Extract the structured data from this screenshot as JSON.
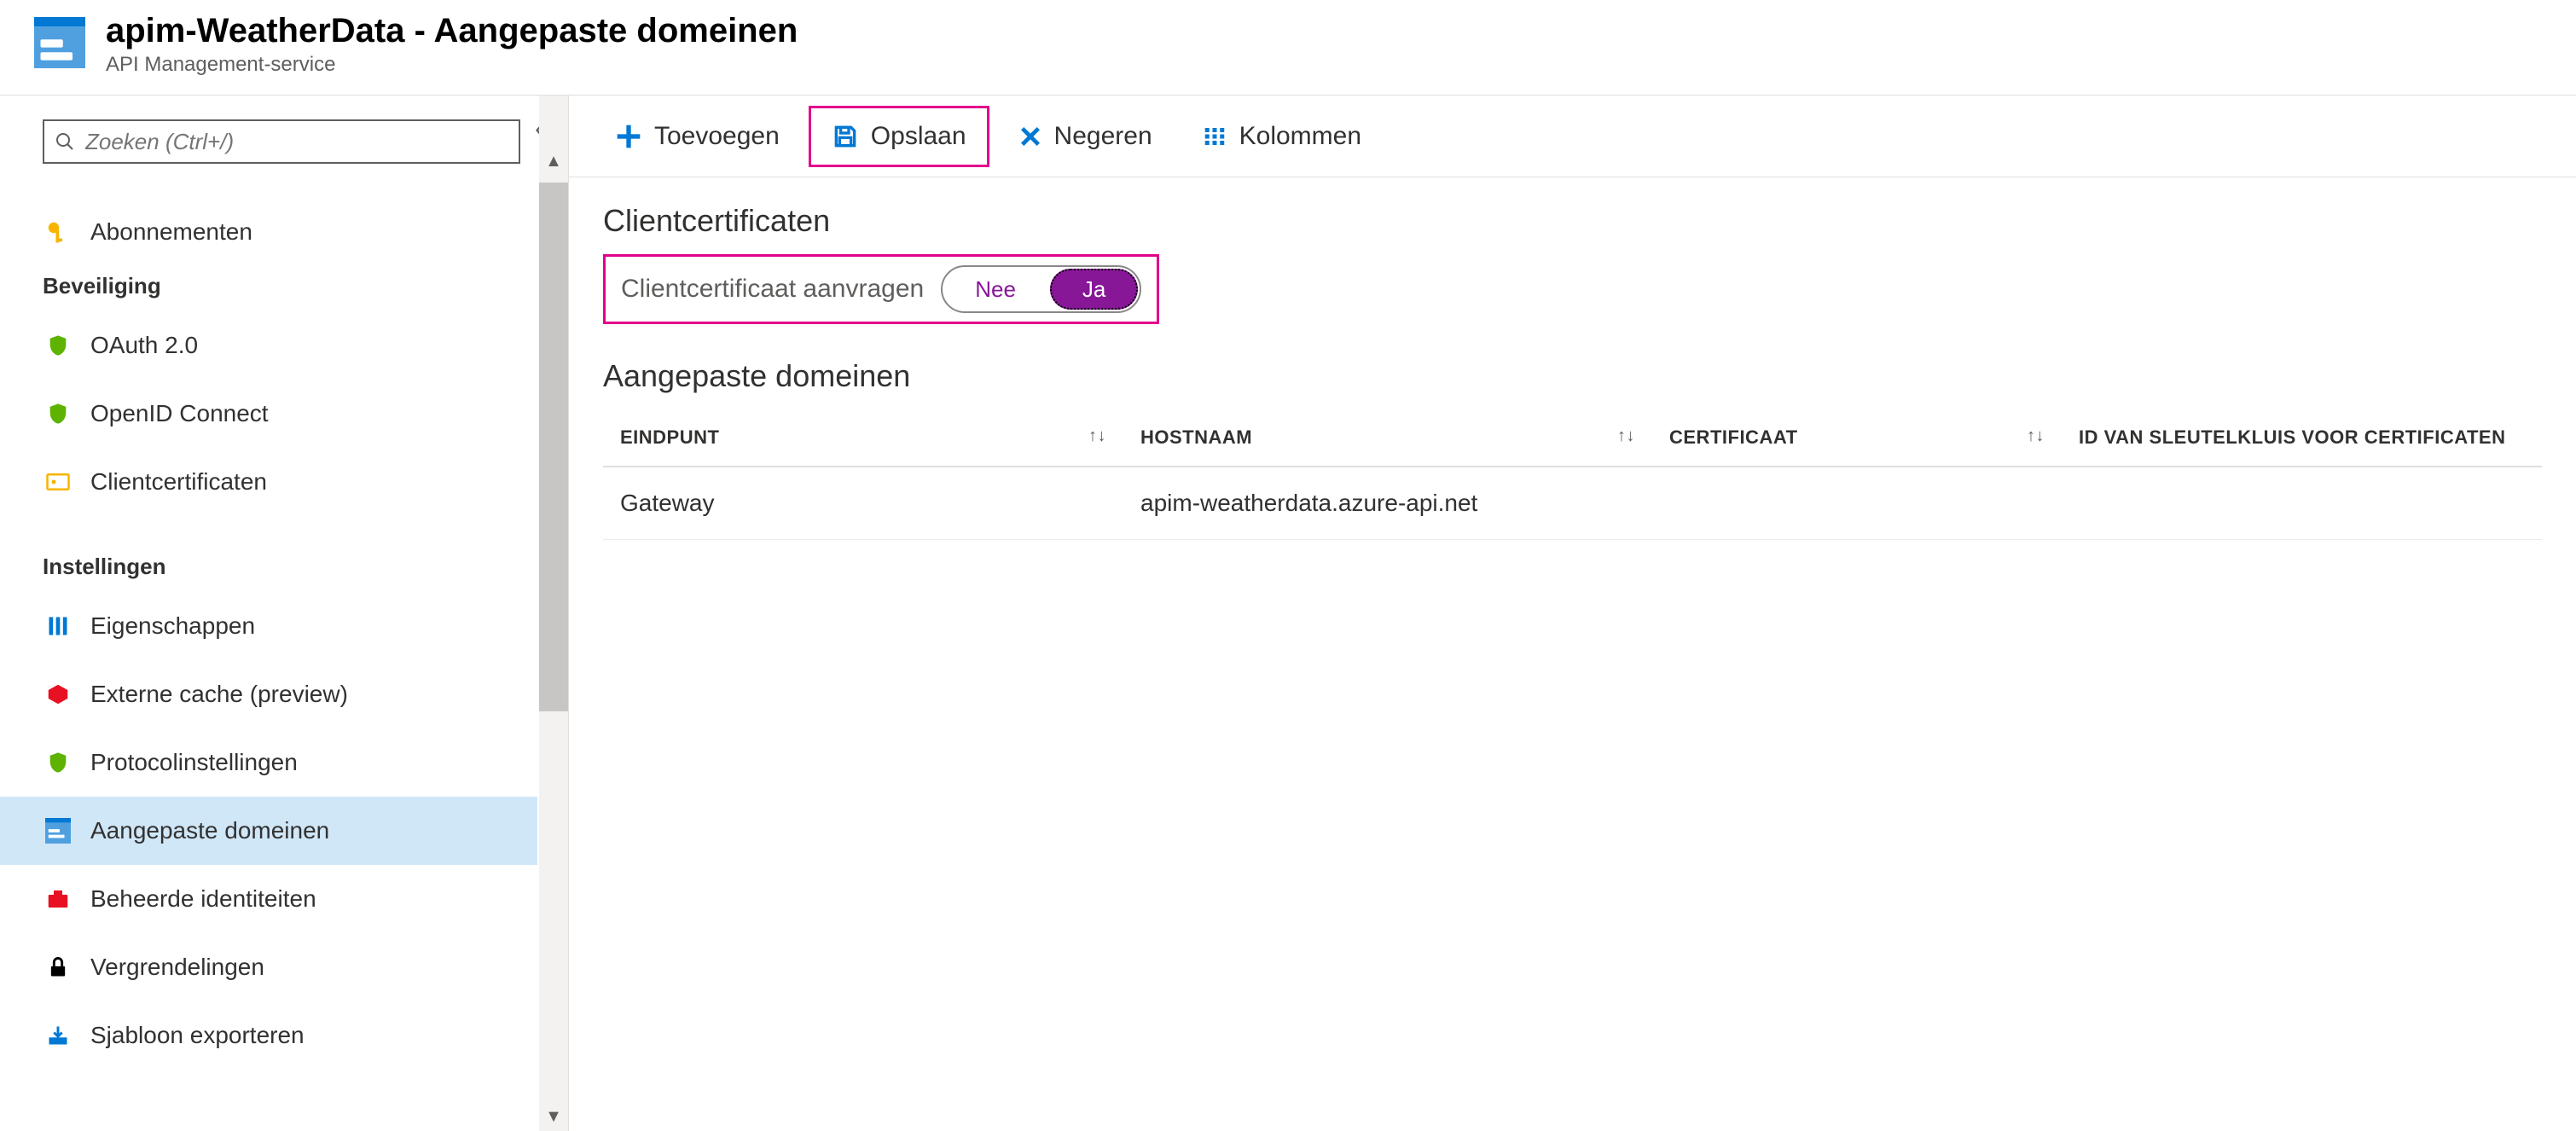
{
  "header": {
    "title": "apim-WeatherData - Aangepaste domeinen",
    "subtitle": "API Management-service"
  },
  "sidebar": {
    "search_placeholder": "Zoeken (Ctrl+/)",
    "item_abonnementen": "Abonnementen",
    "group_beveiliging": "Beveiliging",
    "item_oauth": "OAuth 2.0",
    "item_openid": "OpenID Connect",
    "item_clientcerts": "Clientcertificaten",
    "group_instellingen": "Instellingen",
    "item_eigenschappen": "Eigenschappen",
    "item_externecache": "Externe cache (preview)",
    "item_protocol": "Protocolinstellingen",
    "item_aangepaste": "Aangepaste domeinen",
    "item_beheerde": "Beheerde identiteiten",
    "item_vergrendelingen": "Vergrendelingen",
    "item_sjabloon": "Sjabloon exporteren"
  },
  "toolbar": {
    "toevoegen": "Toevoegen",
    "opslaan": "Opslaan",
    "negeren": "Negeren",
    "kolommen": "Kolommen"
  },
  "client_certs": {
    "section_title": "Clientcertificaten",
    "label": "Clientcertificaat aanvragen",
    "nee": "Nee",
    "ja": "Ja"
  },
  "domains": {
    "section_title": "Aangepaste domeinen",
    "columns": {
      "eindpunt": "Eindpunt",
      "hostnaam": "Hostnaam",
      "certificaat": "Certificaat",
      "sleutelkluis": "Id van sleutelkluis voor certificaten"
    },
    "rows": [
      {
        "eindpunt": "Gateway",
        "hostnaam": "apim-weatherdata.azure-api.net",
        "certificaat": "",
        "sleutelkluis": ""
      }
    ]
  },
  "icons": {
    "sort": "↑↓"
  }
}
